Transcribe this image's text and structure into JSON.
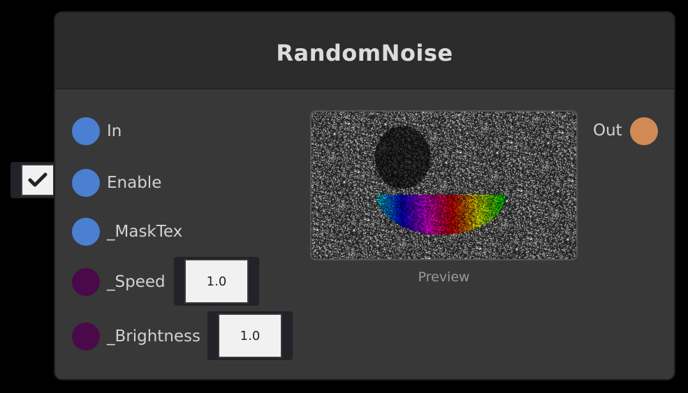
{
  "node": {
    "title": "RandomNoise",
    "inputs": [
      {
        "label": "In",
        "color": "#4b7fd1"
      },
      {
        "label": "Enable",
        "color": "#4b7fd1",
        "checked": true
      },
      {
        "label": "_MaskTex",
        "color": "#4b7fd1"
      },
      {
        "label": "_Speed",
        "color": "#4a0a4a",
        "value": "1.0"
      },
      {
        "label": "_Brightness",
        "color": "#4a0a4a",
        "value": "1.0"
      }
    ],
    "output": {
      "label": "Out",
      "color": "#d18a55"
    },
    "preview_label": "Preview"
  }
}
